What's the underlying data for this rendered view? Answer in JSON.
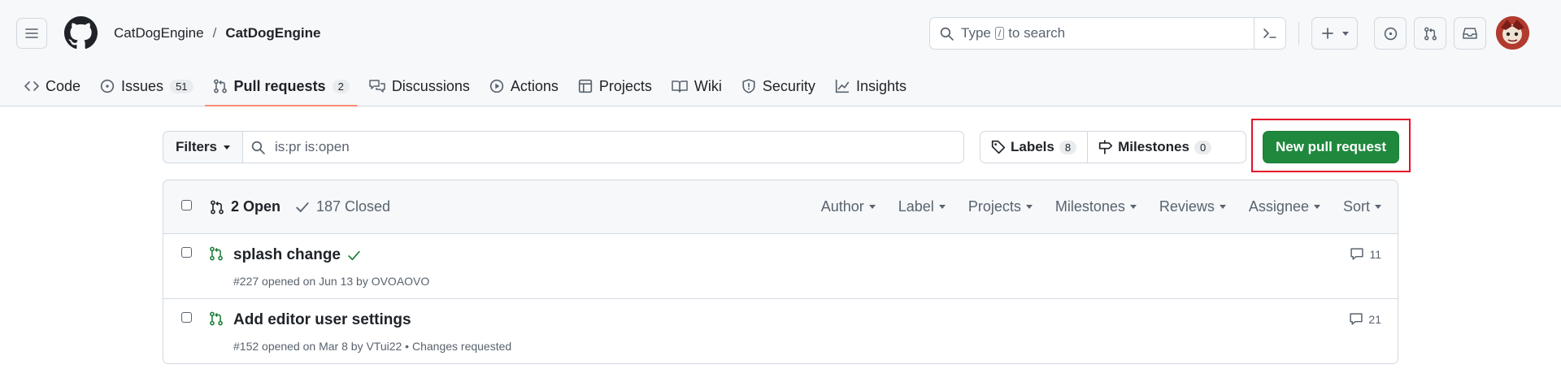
{
  "header": {
    "owner": "CatDogEngine",
    "separator": "/",
    "repo": "CatDogEngine",
    "search": {
      "prefix": "Type",
      "key": "/",
      "suffix": "to search"
    }
  },
  "nav": {
    "code": "Code",
    "issues": "Issues",
    "issues_count": "51",
    "pull_requests": "Pull requests",
    "pull_requests_count": "2",
    "discussions": "Discussions",
    "actions": "Actions",
    "projects": "Projects",
    "wiki": "Wiki",
    "security": "Security",
    "insights": "Insights"
  },
  "toolbar": {
    "filters_label": "Filters",
    "query": "is:pr is:open",
    "labels_label": "Labels",
    "labels_count": "8",
    "milestones_label": "Milestones",
    "milestones_count": "0",
    "new_pr_label": "New pull request"
  },
  "list_header": {
    "open": "2 Open",
    "closed": "187 Closed",
    "author": "Author",
    "label": "Label",
    "projects": "Projects",
    "milestones": "Milestones",
    "reviews": "Reviews",
    "assignee": "Assignee",
    "sort": "Sort"
  },
  "pull_requests": [
    {
      "title": "splash change",
      "meta": "#227 opened on Jun 13 by OVOAOVO",
      "comments": "11",
      "status": "success"
    },
    {
      "title": "Add editor user settings",
      "meta": "#152 opened on Mar 8 by VTui22 • Changes requested",
      "comments": "21"
    }
  ],
  "colors": {
    "accent_green": "#1f883d",
    "open_green": "#1a7f37",
    "highlight_red": "#e5112a",
    "nav_underline": "#fd8c73"
  }
}
